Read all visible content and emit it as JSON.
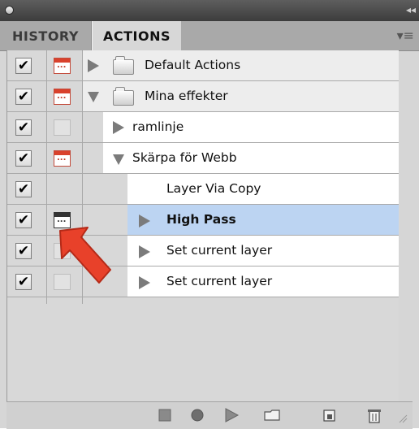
{
  "window": {
    "collapse_glyph": "◂◂"
  },
  "tabs": [
    {
      "label": "HISTORY",
      "active": false
    },
    {
      "label": "ACTIONS",
      "active": true
    }
  ],
  "panel_menu_glyph": "▾≡",
  "rows": [
    {
      "label": "Default Actions",
      "checked": true,
      "dialog": "red",
      "expanded": false,
      "type": "set"
    },
    {
      "label": "Mina effekter",
      "checked": true,
      "dialog": "red",
      "expanded": true,
      "type": "set"
    },
    {
      "label": "ramlinje",
      "checked": true,
      "dialog": "empty",
      "expanded": false,
      "type": "action"
    },
    {
      "label": "Skärpa för Webb",
      "checked": true,
      "dialog": "red",
      "expanded": true,
      "type": "action"
    },
    {
      "label": "Layer Via Copy",
      "checked": true,
      "dialog": "none",
      "expanded": false,
      "type": "command"
    },
    {
      "label": "High Pass",
      "checked": true,
      "dialog": "dark",
      "expanded": false,
      "type": "command",
      "selected": true
    },
    {
      "label": "Set current layer",
      "checked": true,
      "dialog": "empty",
      "expanded": false,
      "type": "command"
    },
    {
      "label": "Set current layer",
      "checked": true,
      "dialog": "empty",
      "expanded": false,
      "type": "command"
    }
  ],
  "check_glyph": "✔",
  "toolbar": {
    "icons": [
      "stop-icon",
      "record-icon",
      "play-icon",
      "new-set-icon",
      "new-action-icon",
      "delete-icon"
    ]
  },
  "colors": {
    "selected_row": "#bcd4f2",
    "dialog_red": "#d9412c",
    "arrow_red": "#e8412a"
  }
}
